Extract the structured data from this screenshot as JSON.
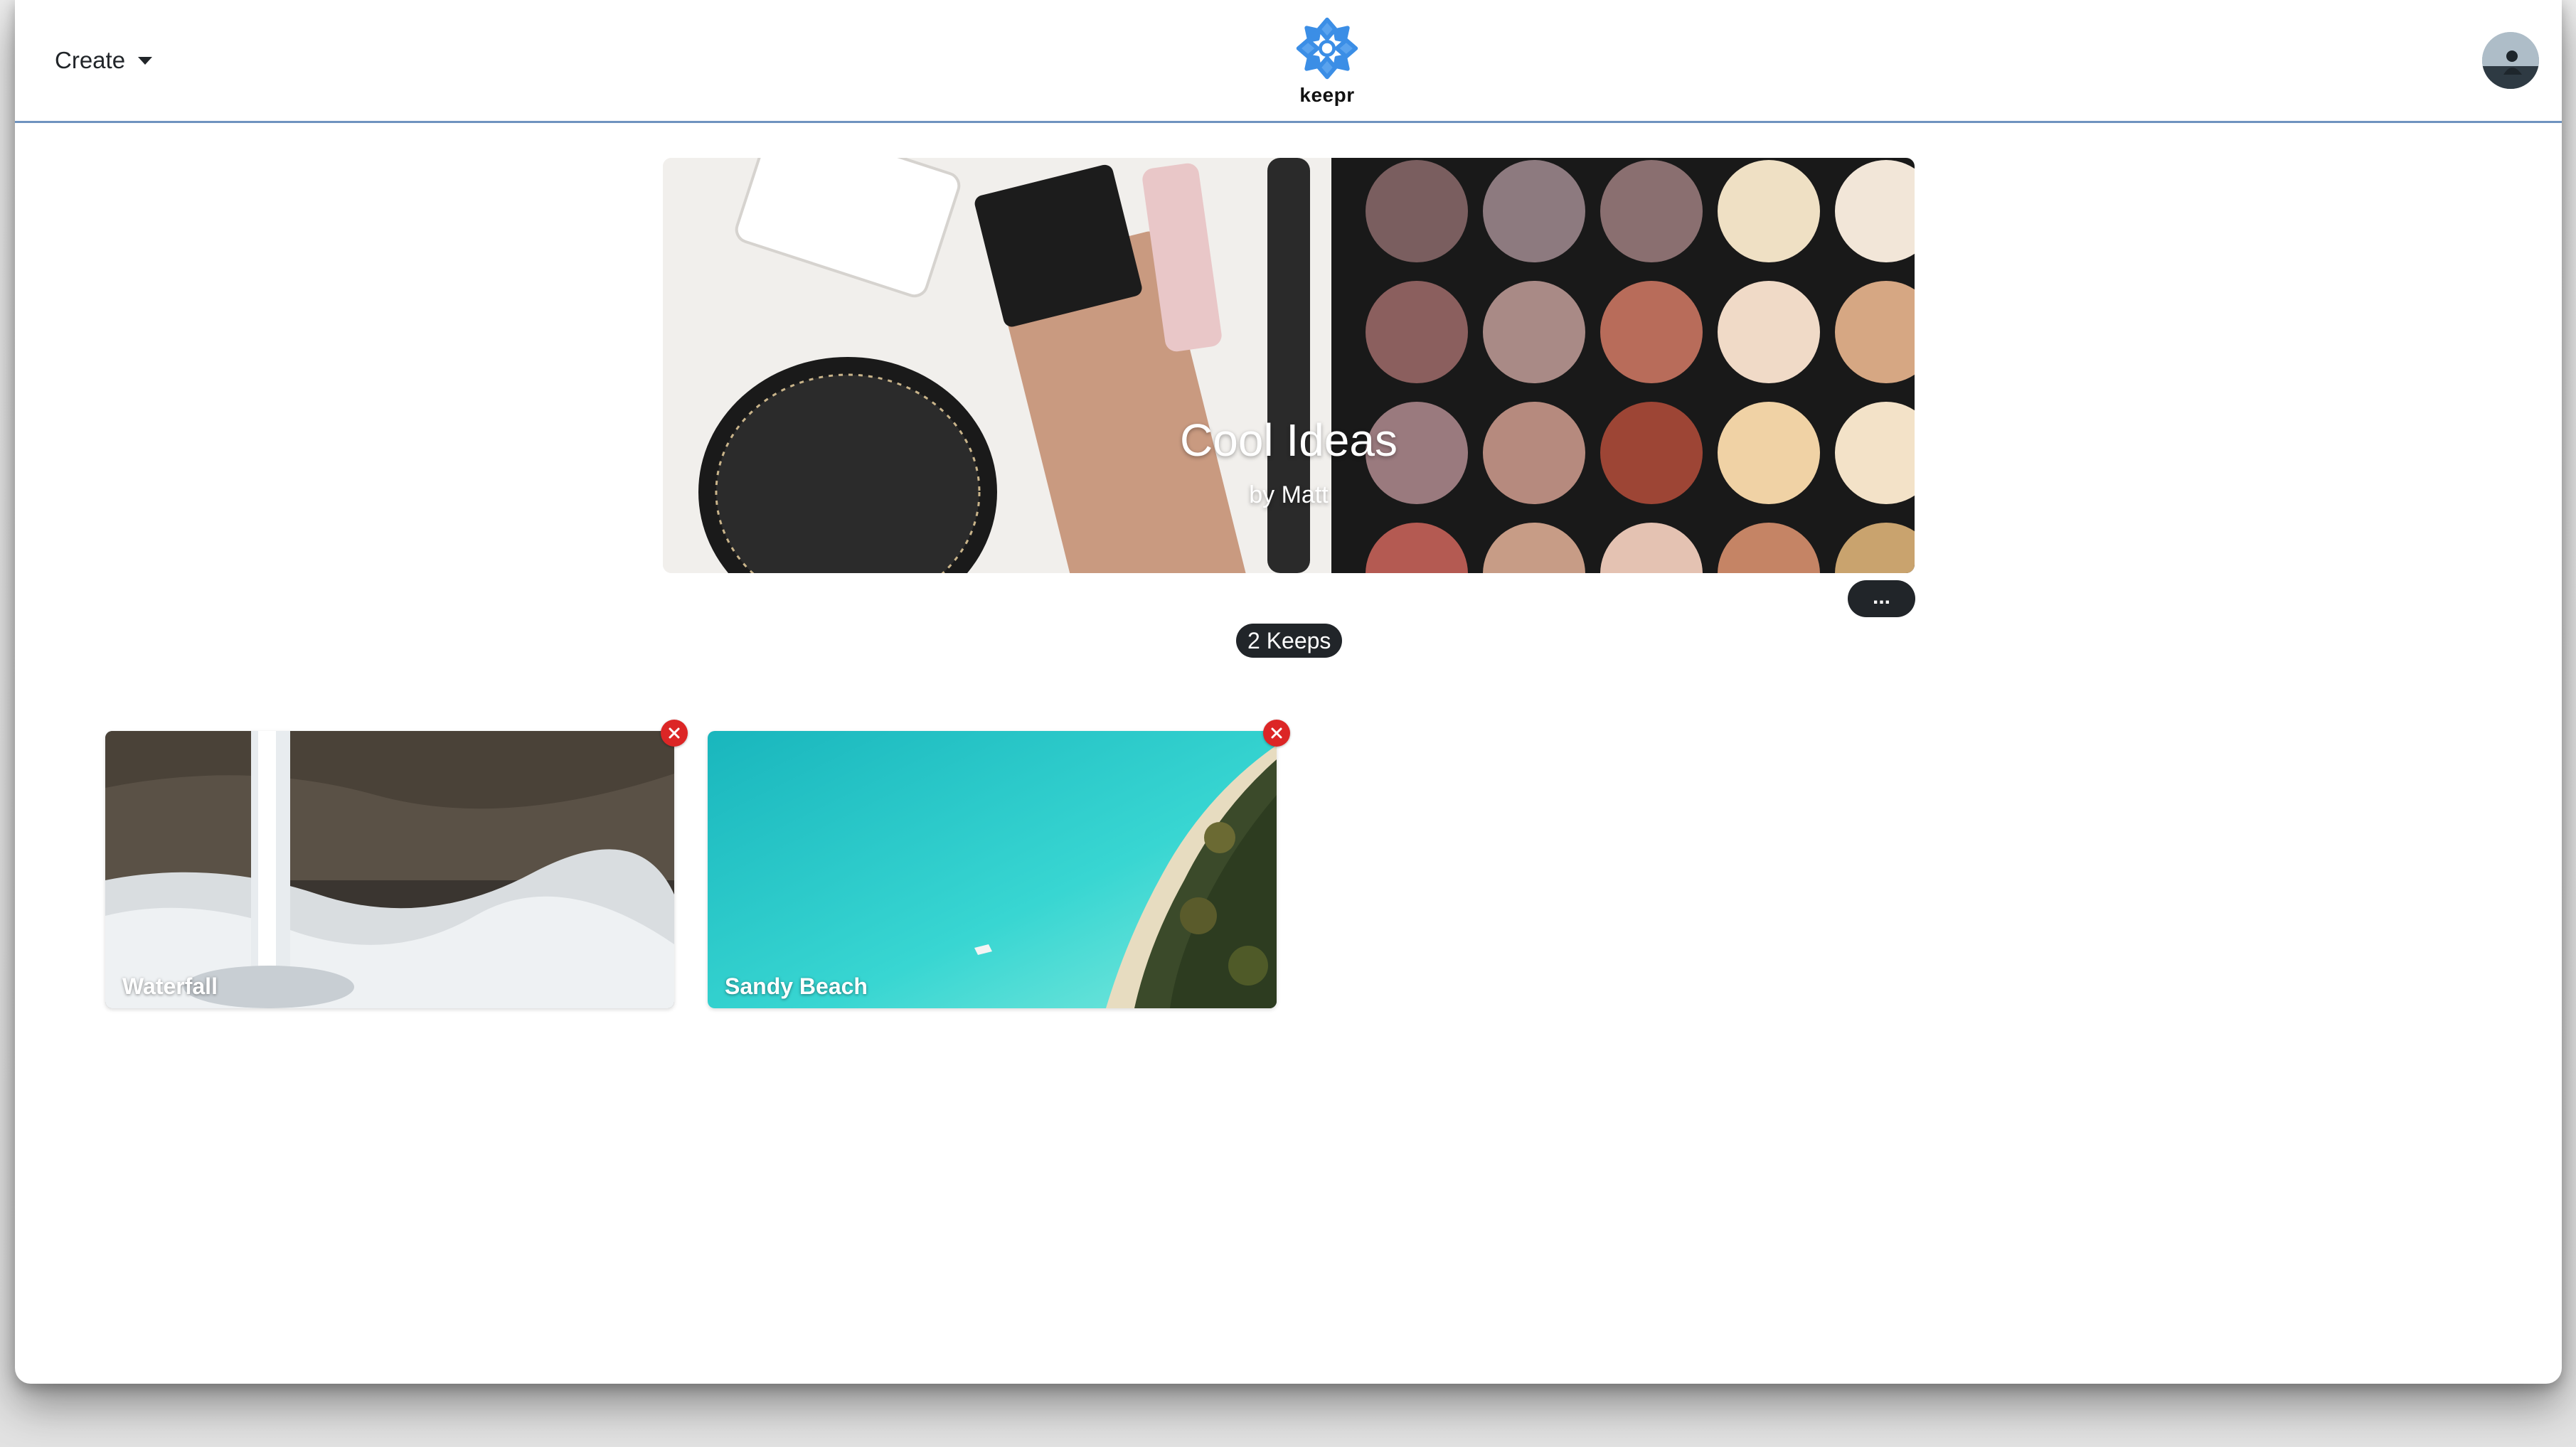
{
  "navbar": {
    "create_label": "Create",
    "brand_name": "keepr",
    "brand_icon": "snowflake-flower-logo",
    "avatar_icon": "user-avatar",
    "accent_color": "#6f93bf"
  },
  "vault": {
    "title": "Cool Ideas",
    "owner": "by Matt",
    "options_label": "...",
    "keep_count": "2 Keeps"
  },
  "keeps": [
    {
      "name": "Waterfall",
      "remove_icon": "close-icon"
    },
    {
      "name": "Sandy Beach",
      "remove_icon": "close-icon"
    }
  ],
  "colors": {
    "pill_bg": "#212529",
    "remove_bg": "#dc2626",
    "logo_blue": "#3b8ee6"
  }
}
